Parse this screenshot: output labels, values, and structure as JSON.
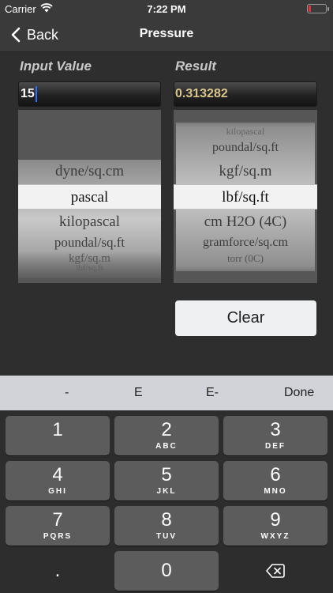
{
  "status_bar": {
    "carrier": "Carrier",
    "time": "7:22 PM"
  },
  "nav": {
    "back_label": "Back",
    "title": "Pressure"
  },
  "labels": {
    "input": "Input Value",
    "result": "Result"
  },
  "input": {
    "value": "15"
  },
  "result": {
    "value": "0.313282"
  },
  "input_picker": {
    "items": [
      "dyne/sq.cm",
      "pascal",
      "kilopascal",
      "poundal/sq.ft",
      "kgf/sq.m",
      "lbf/sq.ft"
    ],
    "selected": "pascal"
  },
  "result_picker": {
    "items": [
      "kilopascal",
      "poundal/sq.ft",
      "kgf/sq.m",
      "lbf/sq.ft",
      "cm H2O (4C)",
      "gramforce/sq.cm",
      "torr (0C)"
    ],
    "selected": "lbf/sq.ft"
  },
  "clear_label": "Clear",
  "accessory": {
    "minus": "-",
    "e": "E",
    "e_minus": "E-",
    "done": "Done"
  },
  "keys": [
    {
      "digit": "1",
      "letters": ""
    },
    {
      "digit": "2",
      "letters": "ABC"
    },
    {
      "digit": "3",
      "letters": "DEF"
    },
    {
      "digit": "4",
      "letters": "GHI"
    },
    {
      "digit": "5",
      "letters": "JKL"
    },
    {
      "digit": "6",
      "letters": "MNO"
    },
    {
      "digit": "7",
      "letters": "PQRS"
    },
    {
      "digit": "8",
      "letters": "TUV"
    },
    {
      "digit": "9",
      "letters": "WXYZ"
    }
  ],
  "decimal_key": ".",
  "zero_key": "0",
  "battery_level": 0.15,
  "colors": {
    "result_text": "#d9c58c",
    "caret": "#2f6fff",
    "battery": "#e0333c"
  }
}
